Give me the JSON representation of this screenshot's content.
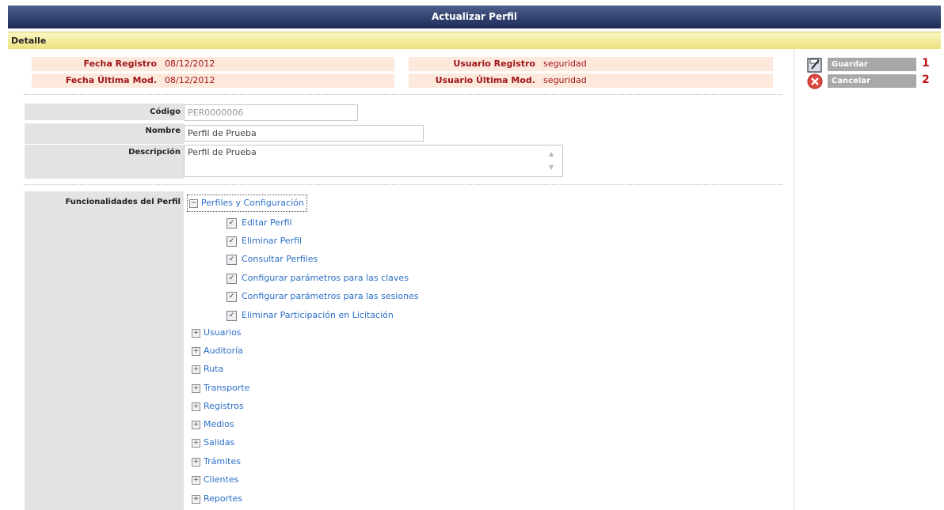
{
  "header": {
    "title": "Actualizar Perfil"
  },
  "section": {
    "title": "Detalle"
  },
  "meta": {
    "fecha_registro_label": "Fecha Registro",
    "fecha_registro": "08/12/2012",
    "fecha_ultima_label": "Fecha Última Mod.",
    "fecha_ultima": "08/12/2012",
    "usuario_registro_label": "Usuario Registro",
    "usuario_registro": "seguridad",
    "usuario_ultima_label": "Usuario Última Mod.",
    "usuario_ultima": "seguridad"
  },
  "form": {
    "codigo_label": "Código",
    "codigo_value": "PER0000006",
    "nombre_label": "Nombre",
    "nombre_value": "Perfil de Prueba",
    "descripcion_label": "Descripción",
    "descripcion_value": "Perfil de Prueba",
    "funcionalidades_label": "Funcionalidades del Perfil"
  },
  "actions": {
    "guardar": "Guardar",
    "guardar_num": "1",
    "cancelar": "Cancelar",
    "cancelar_num": "2"
  },
  "tree": {
    "root": {
      "label": "Perfiles y Configuración",
      "expand": "−"
    },
    "children": [
      {
        "label": "Editar Perfil",
        "check": "✓"
      },
      {
        "label": "Eliminar Perfil",
        "check": "✓"
      },
      {
        "label": "Consultar Perfiles",
        "check": "✓"
      },
      {
        "label": "Configurar parámetros para las claves",
        "check": "✓"
      },
      {
        "label": "Configurar parámetros para las sesiones",
        "check": "✓"
      },
      {
        "label": "Eliminar Participación en Licitación",
        "check": "✓"
      }
    ],
    "collapsed_expand": "+",
    "nodes": [
      "Usuarios",
      "Auditoría",
      "Ruta",
      "Transporte",
      "Registros",
      "Medios",
      "Salidas",
      "Trámites",
      "Clientes",
      "Reportes"
    ]
  },
  "colors": {
    "header_bg": "#1d2c57",
    "section_bg": "#ece27e",
    "meta_bg": "#fde9dc",
    "meta_text": "#a0151a",
    "link": "#2c6fc7",
    "number": "#c0141b"
  }
}
